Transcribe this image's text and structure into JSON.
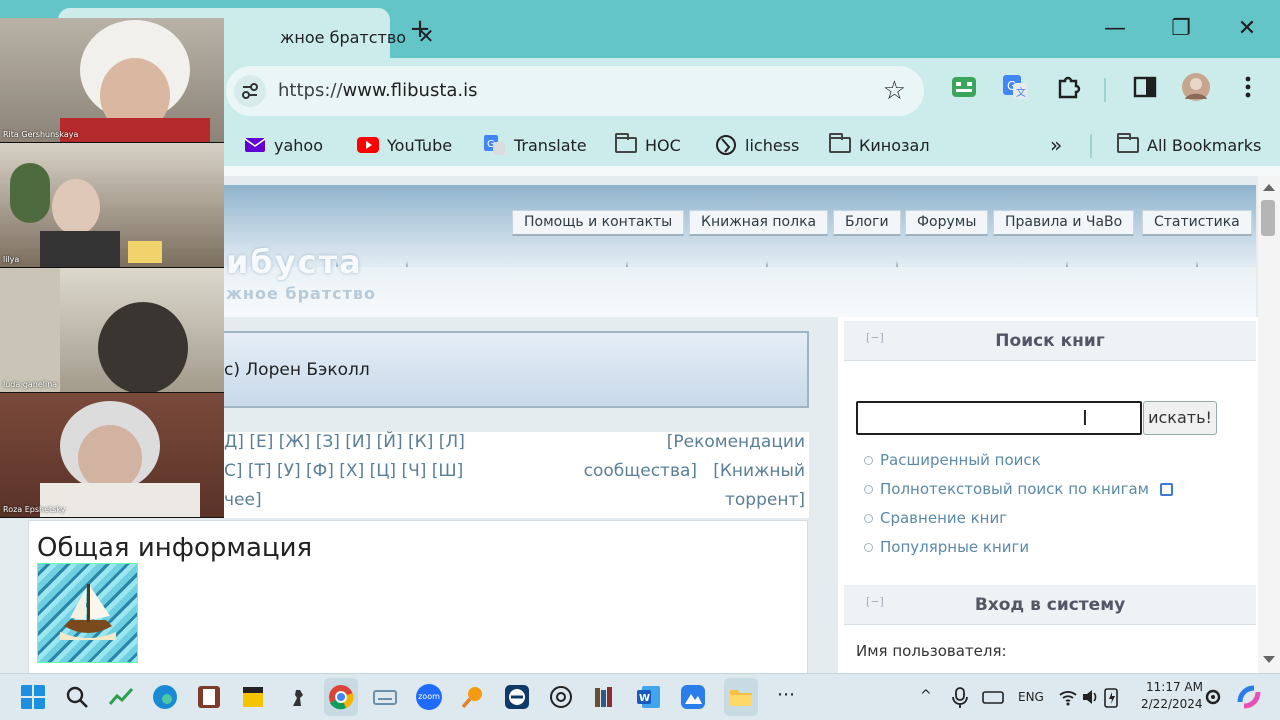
{
  "browser": {
    "tab_title": "жное братство",
    "url_scheme": "https://",
    "url_host": "www.flibusta.is",
    "window_controls": {
      "minimize": "—",
      "maximize": "❐",
      "close": "✕"
    },
    "new_tab": "+",
    "tab_close": "✕"
  },
  "bookmarks": {
    "items": [
      {
        "label": "yahoo",
        "icon": "yahoo-mail-icon"
      },
      {
        "label": "YouTube",
        "icon": "youtube-icon"
      },
      {
        "label": "Translate",
        "icon": "google-translate-icon"
      },
      {
        "label": "НОС",
        "icon": "folder-icon"
      },
      {
        "label": "lichess",
        "icon": "lichess-icon"
      },
      {
        "label": "Кинозал",
        "icon": "folder-icon"
      }
    ],
    "overflow": "»",
    "all_bookmarks": "All Bookmarks"
  },
  "site": {
    "logo": "ибуста",
    "slogan": "жное братство",
    "nav": [
      "Помощь и контакты",
      "Книжная полка",
      "Блоги",
      "Форумы",
      "Правила и ЧаВо",
      "Статистика"
    ],
    "quote": "с) Лорен Бэколл",
    "alphabet_line1": "Д] [Е] [Ж] [З] [И] [Й] [К] [Л]",
    "alphabet_line2": "С] [Т] [У] [Ф] [Х] [Ц] [Ч] [Ш]",
    "alphabet_line3": "чее]",
    "recommend_line1": "[Рекомендации",
    "recommend_line2": "сообщества]   [Книжный",
    "recommend_line3": "торрент]",
    "info_title": "Общая информация"
  },
  "sidebar": {
    "search_title": "Поиск книг",
    "collapse": "[−]",
    "search_button": "искать!",
    "search_value": "",
    "links": [
      "Расширенный поиск",
      "Полнотекстовый поиск по книгам",
      "Сравнение книг",
      "Популярные книги"
    ],
    "login_title": "Вход в систему",
    "username_label": "Имя пользователя:"
  },
  "participants": [
    "Rita Gershunskaya",
    "lilya",
    "luda ganelina",
    "Roza Epshetsky"
  ],
  "taskbar": {
    "language": "ENG",
    "time": "11:17 AM",
    "date": "2/22/2024",
    "zoom_label": "zoom"
  },
  "colors": {
    "tabstrip": "#63c5c8",
    "toolbar": "#cbecea",
    "link": "#5a8aa8"
  }
}
